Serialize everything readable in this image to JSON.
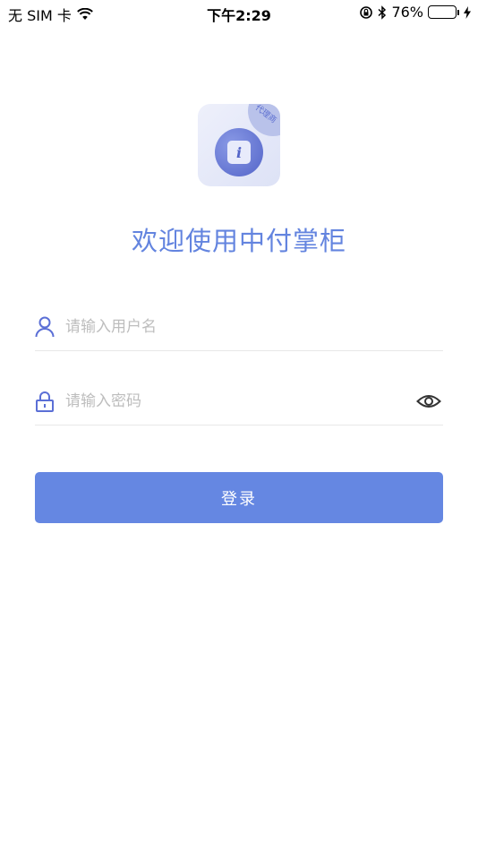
{
  "status_bar": {
    "carrier": "无 SIM 卡",
    "time": "下午2:29",
    "battery_percent_text": "76%",
    "battery_level": 0.76,
    "icons": [
      "wifi-icon",
      "orientation-lock-icon",
      "bluetooth-icon",
      "battery-icon",
      "charging-icon"
    ]
  },
  "logo": {
    "badge_text": "代理商",
    "icon_glyph": "i"
  },
  "welcome_title": "欢迎使用中付掌柜",
  "login_form": {
    "username_placeholder": "请输入用户名",
    "username_value": "",
    "password_placeholder": "请输入密码",
    "password_value": "",
    "login_button_label": "登录"
  },
  "colors": {
    "accent": "#6587e2",
    "title": "#6384df",
    "icon": "#5b6fd6",
    "divider": "#e8e8e8",
    "placeholder": "#bdbdbd"
  }
}
